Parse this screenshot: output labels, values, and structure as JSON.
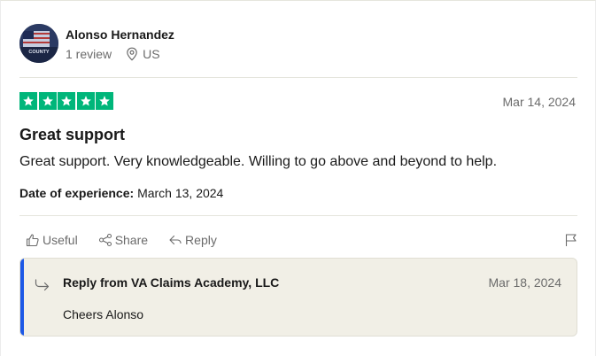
{
  "consumer": {
    "name": "Alonso Hernandez",
    "reviews": "1 review",
    "location": "US",
    "avatar_icon": "flag-avatar-icon",
    "avatar_text": "COUNTY"
  },
  "review": {
    "rating": 5,
    "date": "Mar 14, 2024",
    "title": "Great support",
    "text": "Great support. Very knowledgeable. Willing to go above and beyond to help.",
    "experience_label": "Date of experience:",
    "experience_date": "March 13, 2024"
  },
  "actions": {
    "useful": "Useful",
    "share": "Share",
    "reply": "Reply"
  },
  "reply": {
    "from": "Reply from VA Claims Academy, LLC",
    "date": "Mar 18, 2024",
    "text": "Cheers Alonso"
  },
  "colors": {
    "star_green": "#00b67a",
    "reply_accent": "#1c58e6",
    "reply_background": "#f1efe6"
  }
}
